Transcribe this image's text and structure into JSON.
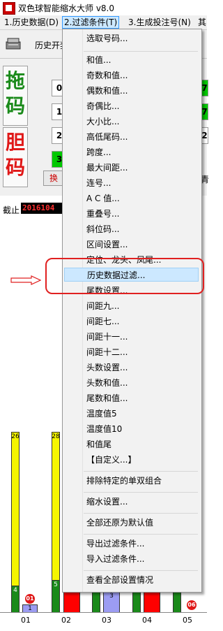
{
  "window": {
    "title": "双色球智能缩水大师 v8.0"
  },
  "menubar": {
    "items": [
      "1.历史数据(D)",
      "2.过滤条件(T)",
      "3.生成投注号(N)",
      "其"
    ]
  },
  "toolbar": {
    "label": "历史开奖"
  },
  "left_panel": {
    "drag_chars": [
      "拖",
      "码"
    ],
    "bile_chars": [
      "胆",
      "码"
    ],
    "rows": [
      "0",
      "1",
      "2",
      "3"
    ],
    "right_fragments": [
      "7",
      "7",
      "2"
    ],
    "swap_button": "换",
    "clear_fragment": "青"
  },
  "status": {
    "label": "截止",
    "date": "2016104"
  },
  "dropdown": {
    "items": [
      "选取号码...",
      "和值...",
      "奇数和值...",
      "偶数和值...",
      "奇偶比...",
      "大小比...",
      "高低尾码...",
      "跨度...",
      "最大间距...",
      "连号...",
      "A C 值...",
      "重叠号...",
      "斜位码...",
      "区间设置...",
      "定位、龙头、凤尾...",
      "历史数据过滤...",
      "尾数设置...",
      "间距九...",
      "间距七...",
      "间距十一...",
      "间距十二...",
      "头数设置...",
      "头数和值...",
      "尾数和值...",
      "温度值5",
      "温度值10",
      "和值尾",
      "【自定义...】",
      "排除特定的单双组合",
      "缩水设置...",
      "全部还原为默认值",
      "导出过滤条件...",
      "导入过滤条件...",
      "查看全部设置情况"
    ],
    "highlighted": "历史数据过滤..."
  },
  "chart": {
    "axis_labels": [
      "01",
      "02",
      "03",
      "04",
      "05"
    ],
    "yellow_labels": [
      "26",
      "28"
    ],
    "green_labels": [
      "4",
      "5"
    ],
    "blue_label": "3",
    "small_label": "1",
    "balls": [
      "01",
      "06"
    ]
  },
  "colors": {
    "highlight": "#cce8ff",
    "annotation": "#e02020",
    "bar_yellow": "#f5f500",
    "bar_red": "#ff0000"
  }
}
